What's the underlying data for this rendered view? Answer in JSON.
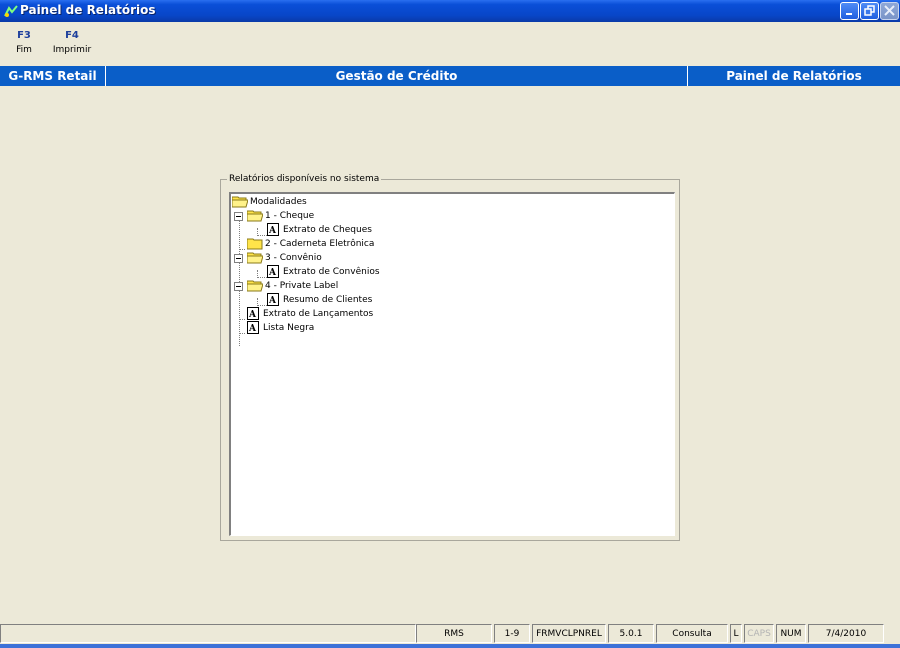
{
  "window": {
    "title": "Painel de Relatórios"
  },
  "function_keys": [
    {
      "key": "F3",
      "label": "Fim"
    },
    {
      "key": "F4",
      "label": "Imprimir"
    }
  ],
  "header": {
    "left": "G-RMS Retail",
    "center": "Gestão de Crédito",
    "right": "Painel de Relatórios"
  },
  "report_panel": {
    "legend": "Relatórios disponíveis no sistema",
    "tree": {
      "root": "Modalidades",
      "cheque": "1 - Cheque",
      "cheque_report": "Extrato de Cheques",
      "caderneta": "2 - Caderneta Eletrônica",
      "convenio": "3 - Convênio",
      "convenio_report": "Extrato de Convênios",
      "private_label": "4 - Private Label",
      "private_label_report": "Resumo de Clientes",
      "extrato_lancamentos": "Extrato de Lançamentos",
      "lista_negra": "Lista Negra"
    }
  },
  "status_bar": {
    "system": "RMS",
    "page": "1-9",
    "form": "FRMVCLPNREL",
    "version": "5.0.1",
    "mode": "Consulta",
    "l": "L",
    "caps": "CAPS",
    "num": "NUM",
    "date": "7/4/2010"
  },
  "colors": {
    "header_band": "#0a5ec8",
    "background": "#ece9d8",
    "folder": "#ffe44a"
  }
}
